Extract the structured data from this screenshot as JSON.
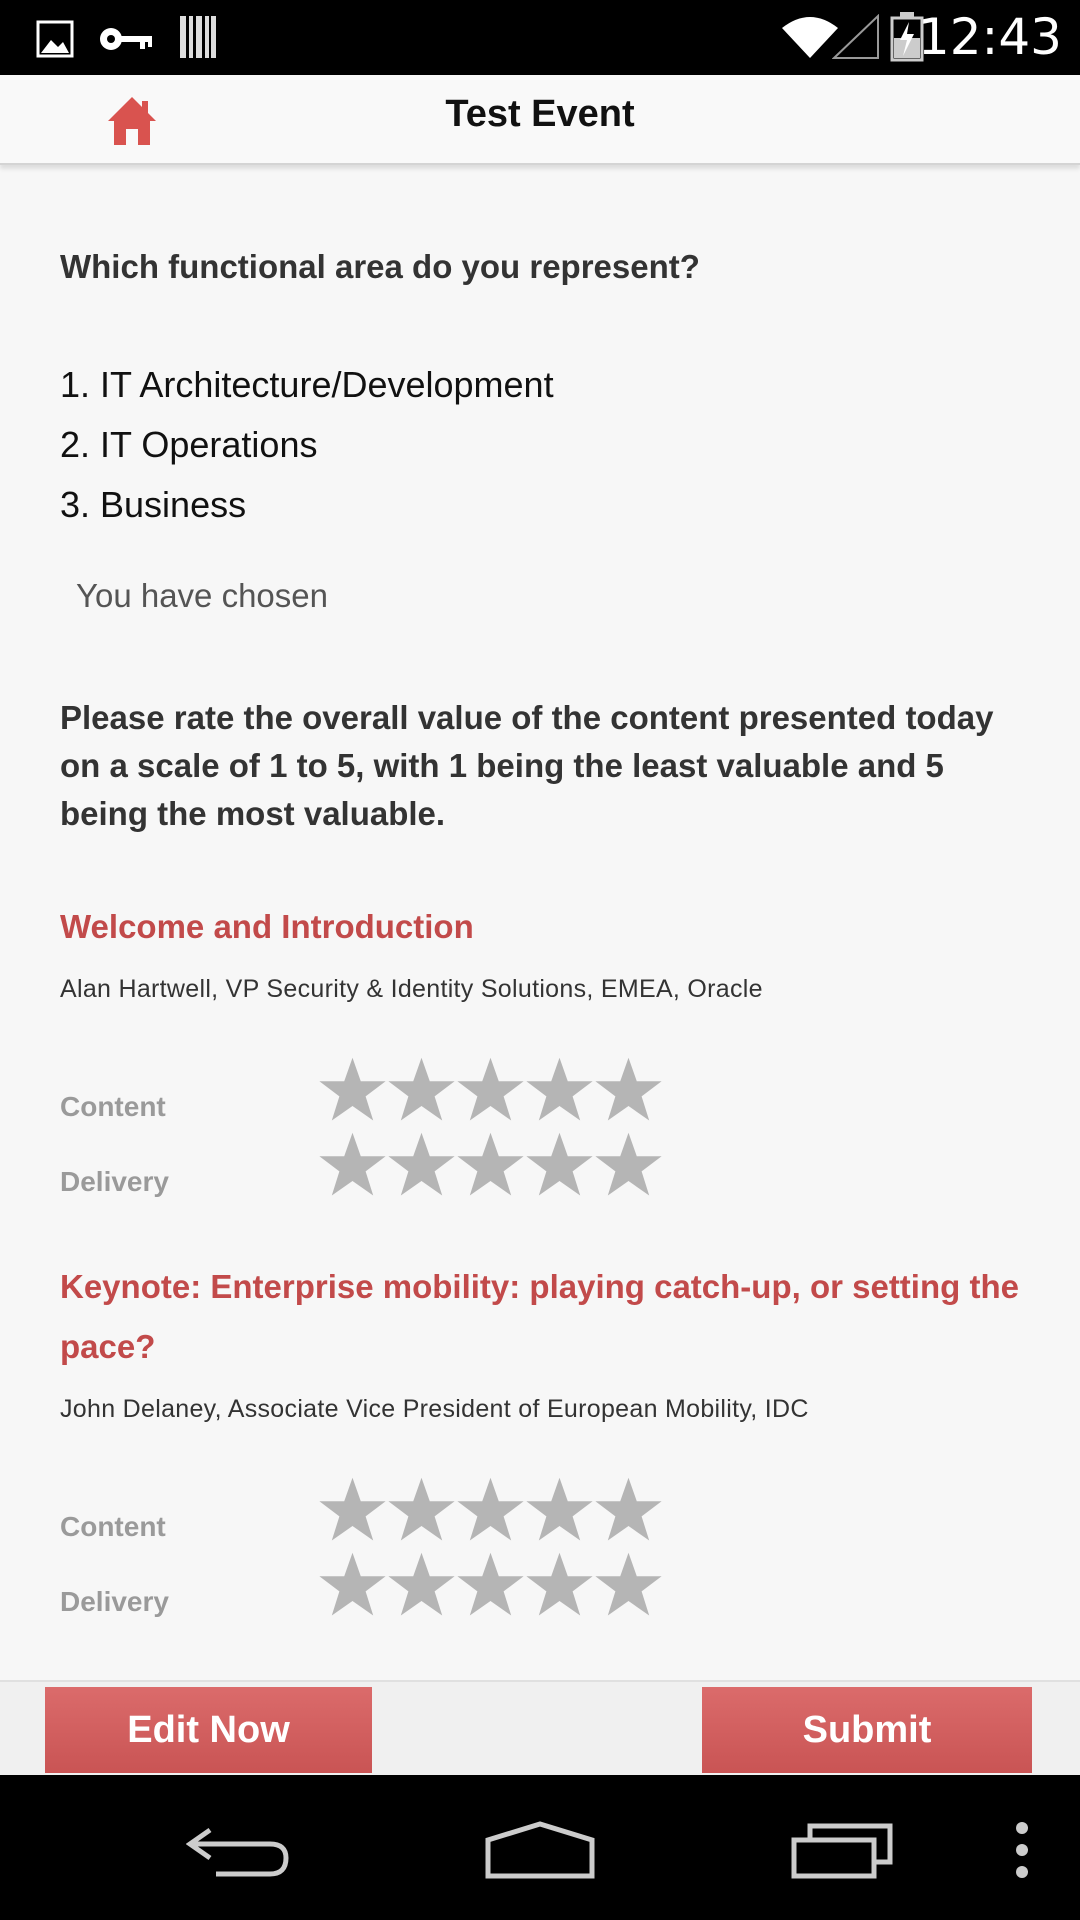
{
  "status_bar": {
    "time": "12:43",
    "icons": [
      "image-icon",
      "key-icon",
      "barcode-icon",
      "wifi-icon",
      "signal-icon",
      "battery-icon"
    ]
  },
  "app_bar": {
    "title": "Test Event",
    "home_icon": "home-icon",
    "home_color": "#d9534f"
  },
  "question1": {
    "text": "Which functional area do you represent?",
    "options": [
      "1. IT Architecture/Development",
      "2. IT Operations",
      "3. Business"
    ],
    "chosen_text": "You have chosen"
  },
  "question2": {
    "text": "Please rate the overall value of the content presented today on a scale of 1 to 5, with 1 being the least valuable and 5 being the most valuable."
  },
  "sessions": [
    {
      "title": "Welcome and Introduction",
      "speaker": "Alan Hartwell, VP Security & Identity Solutions, EMEA, Oracle",
      "content_label": "Content",
      "delivery_label": "Delivery",
      "content_rating": 0,
      "delivery_rating": 0
    },
    {
      "title": "Keynote: Enterprise mobility: playing catch-up, or setting the pace?",
      "speaker": "John Delaney, Associate Vice President of European Mobility, IDC",
      "content_label": "Content",
      "delivery_label": "Delivery",
      "content_rating": 0,
      "delivery_rating": 0
    }
  ],
  "actions": {
    "edit_label": "Edit Now",
    "submit_label": "Submit"
  },
  "colors": {
    "accent": "#c24a4a",
    "button": "#d65f5f",
    "star_empty": "#b5b5b5"
  }
}
